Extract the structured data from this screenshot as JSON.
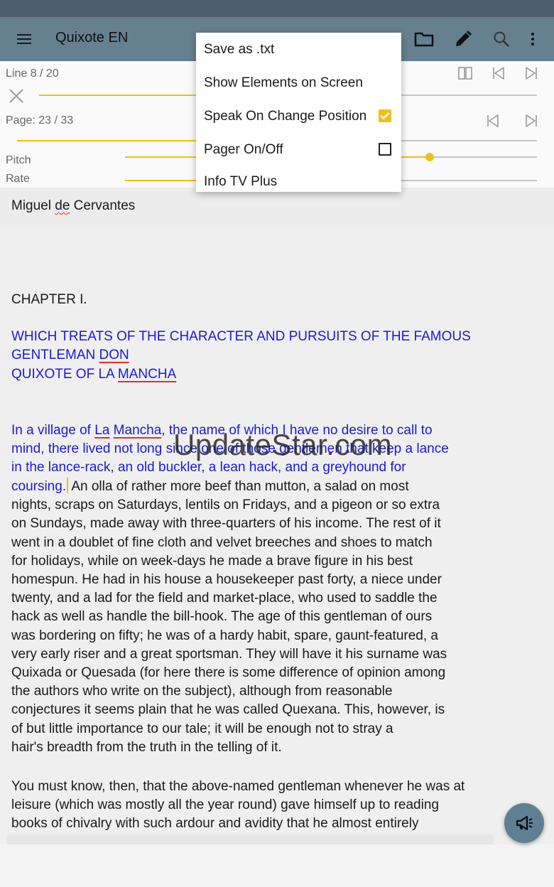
{
  "app_bar": {
    "title": "Quixote EN",
    "icons": [
      "menu-icon",
      "folder-icon",
      "pencil-icon",
      "search-icon",
      "more-vert-icon"
    ]
  },
  "controls": {
    "line_label": "Line 8 / 20",
    "line_progress": 0.4,
    "page_label": "Page: 23 / 33",
    "page_progress": 0.7,
    "pitch_label": "Pitch",
    "pitch_value": 0.74,
    "rate_label": "Rate",
    "rate_value": 0.5
  },
  "menu": {
    "items": [
      {
        "label": "Save as .txt"
      },
      {
        "label": "Show Elements on Screen"
      },
      {
        "label": "Speak On Change Position",
        "checked": true
      },
      {
        "label": "Pager On/Off",
        "checked": false
      },
      {
        "label": "Info TV Plus"
      }
    ]
  },
  "document": {
    "author": {
      "p1": "Miguel ",
      "p2": "de",
      "p3": " Cervantes"
    },
    "chapter": "CHAPTER I.",
    "heading": {
      "l1": "WHICH TREATS OF THE CHARACTER AND PURSUITS OF THE FAMOUS",
      "l2a": "GENTLEMAN ",
      "l2b": "DON",
      "l3a": "QUIXOTE OF LA ",
      "l3b": "MANCHA"
    },
    "para1": {
      "l1a": "In a village of ",
      "l1b": "La",
      "l1c": " ",
      "l1d": "Mancha",
      "l1e": ", the name of which I have no desire to call to",
      "l2": "mind, there lived not long since one of those gentlemen that keep a lance",
      "l3": "in the lance-rack, an old buckler, a lean hack, and a greyhound for",
      "l4a": "coursing.",
      "l4b": " An olla of rather more beef than mutton, a salad on most",
      "lines": [
        "nights, scraps on Saturdays, lentils on Fridays, and a pigeon or so extra",
        "on Sundays, made away with three-quarters of his income. The rest of it",
        "went in a doublet of fine cloth and velvet breeches and shoes to match",
        "for holidays, while on week-days he made a brave figure in his best",
        "homespun. He had in his house a housekeeper past forty, a niece under",
        "twenty, and a lad for the field and market-place, who used to saddle the",
        "hack as well as handle the bill-hook. The age of this gentleman of ours",
        "was bordering on fifty; he was of a hardy habit, spare, gaunt-featured, a",
        "very early riser and a great sportsman. They will have it his surname was",
        "Quixada or Quesada (for here there is some difference of opinion among",
        "the authors who write on the subject), although from reasonable",
        "conjectures it seems plain that he was called Quexana. This, however, is",
        "of but little importance to our tale; it will be enough not to stray a",
        "hair's breadth from the truth in the telling of it."
      ]
    },
    "para2": {
      "lines": [
        "You must know, then, that the above-named gentleman whenever he was at",
        "leisure (which was mostly all the year round) gave himself up to reading",
        "books of chivalry with such ardour and avidity that he almost entirely"
      ]
    }
  },
  "watermark": "UpdateStar.com",
  "fab": {
    "icon": "megaphone-icon"
  },
  "colors": {
    "app_bar": "#66808f",
    "status_bar": "#4d5d69",
    "accent": "#f2bf1a",
    "highlight_text": "#1a1ad6",
    "fab": "#5f7f93"
  }
}
